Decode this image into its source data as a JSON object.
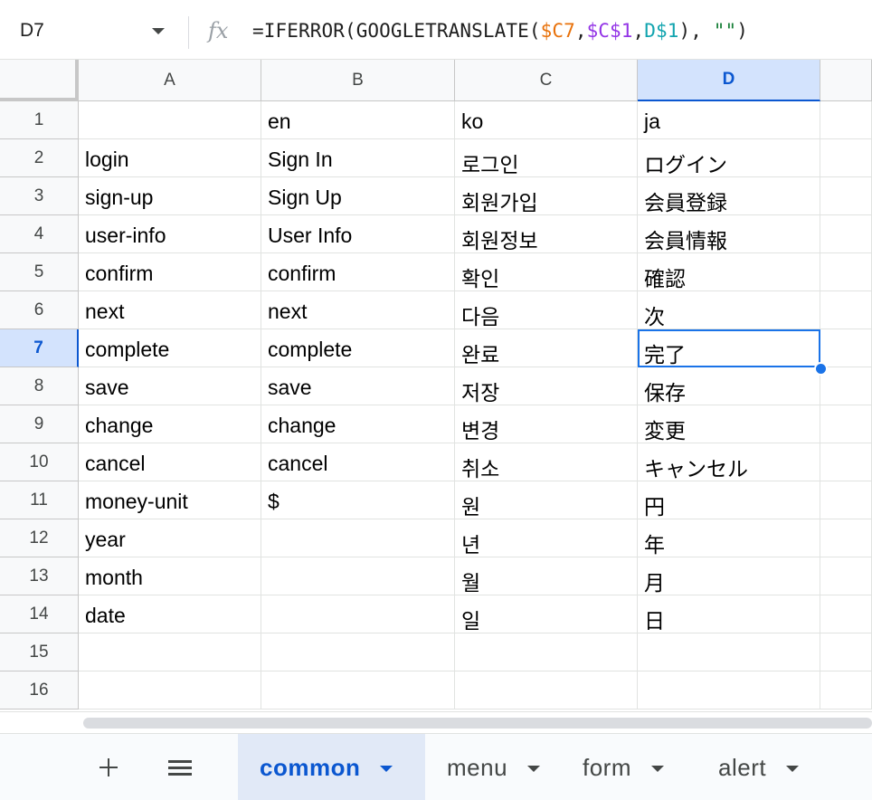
{
  "formula_bar": {
    "cell_ref": "D7",
    "fx_label": "fx",
    "formula_parts": [
      {
        "text": "=IFERROR(GOOGLETRANSLATE(",
        "color": "#1f1f1f"
      },
      {
        "text": "$C7",
        "color": "#e8710a"
      },
      {
        "text": ",",
        "color": "#1f1f1f"
      },
      {
        "text": "$C$1",
        "color": "#9334e6"
      },
      {
        "text": ",",
        "color": "#1f1f1f"
      },
      {
        "text": "D$1",
        "color": "#12a4af"
      },
      {
        "text": "), ",
        "color": "#1f1f1f"
      },
      {
        "text": "\"\"",
        "color": "#188038"
      },
      {
        "text": ")",
        "color": "#1f1f1f"
      }
    ]
  },
  "grid": {
    "columns": [
      "A",
      "B",
      "C",
      "D"
    ],
    "selected_column": "D",
    "row_numbers": [
      "1",
      "2",
      "3",
      "4",
      "5",
      "6",
      "7",
      "8",
      "9",
      "10",
      "11",
      "12",
      "13",
      "14",
      "15",
      "16"
    ],
    "selected_row": "7",
    "rows": [
      [
        "",
        "en",
        "ko",
        "ja"
      ],
      [
        "login",
        "Sign In",
        "로그인",
        "ログイン"
      ],
      [
        "sign-up",
        "Sign Up",
        "회원가입",
        "会員登録"
      ],
      [
        "user-info",
        "User Info",
        "회원정보",
        "会員情報"
      ],
      [
        "confirm",
        "confirm",
        "확인",
        "確認"
      ],
      [
        "next",
        "next",
        "다음",
        "次"
      ],
      [
        "complete",
        "complete",
        "완료",
        "完了"
      ],
      [
        "save",
        "save",
        "저장",
        "保存"
      ],
      [
        "change",
        "change",
        "변경",
        "変更"
      ],
      [
        "cancel",
        "cancel",
        "취소",
        "キャンセル"
      ],
      [
        "money-unit",
        "$",
        "원",
        "円"
      ],
      [
        "year",
        "",
        "년",
        "年"
      ],
      [
        "month",
        "",
        "월",
        "月"
      ],
      [
        "date",
        "",
        "일",
        "日"
      ],
      [
        "",
        "",
        "",
        ""
      ],
      [
        "",
        "",
        "",
        ""
      ]
    ]
  },
  "sheet_tabs": {
    "add_icon": "plus-icon",
    "list_icon": "hamburger-list-icon",
    "tabs": [
      {
        "label": "common",
        "active": true
      },
      {
        "label": "menu",
        "active": false
      },
      {
        "label": "form",
        "active": false
      },
      {
        "label": "alert",
        "active": false
      }
    ]
  }
}
